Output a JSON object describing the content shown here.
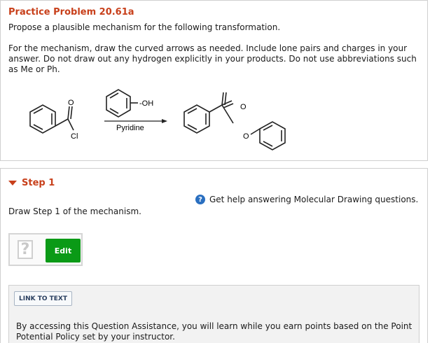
{
  "problem": {
    "title": "Practice Problem 20.61a",
    "subtitle": "Propose a plausible mechanism for the following transformation.",
    "instructions": "For the mechanism, draw the curved arrows as needed. Include lone pairs and charges in your answer. Do not draw out any hydrogen explicitly in your products. Do not use abbreviations such as Me or Ph."
  },
  "reaction": {
    "reagent_label": "-OH",
    "conditions_label": "Pyridine",
    "o_label": "O",
    "cl_label": "Cl"
  },
  "step": {
    "title": "Step 1",
    "help_link": "Get help answering Molecular Drawing questions.",
    "help_icon": "?",
    "prompt": "Draw Step 1 of the mechanism.",
    "placeholder_icon": "?",
    "edit_label": "Edit"
  },
  "assistance": {
    "link_label": "LINK TO TEXT",
    "text": "By accessing this Question Assistance, you will learn while you earn points based on the Point Potential Policy set by your instructor."
  },
  "colors": {
    "accent": "#c8401b",
    "edit_button": "#0a9a16",
    "help_icon": "#2a6fc0"
  }
}
